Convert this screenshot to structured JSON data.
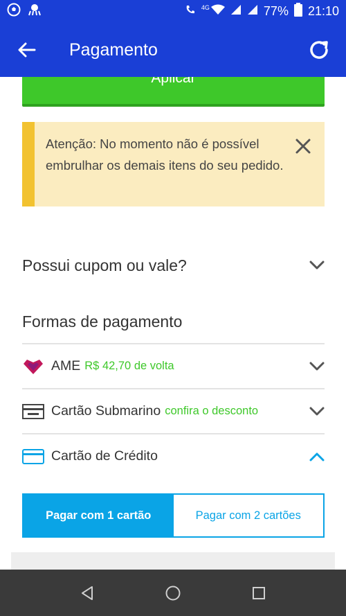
{
  "status": {
    "network": "4G",
    "battery": "77%",
    "time": "21:10"
  },
  "header": {
    "title": "Pagamento"
  },
  "apply": {
    "label": "Aplicar"
  },
  "alert": {
    "message": "Atenção: No momento não é possível embrulhar os demais itens do seu pedido."
  },
  "coupon": {
    "title": "Possui cupom ou vale?"
  },
  "payment": {
    "title": "Formas de pagamento",
    "methods": [
      {
        "name": "AME",
        "extra": "R$ 42,70 de volta",
        "icon": "ame-heart-icon",
        "expanded": false
      },
      {
        "name": "Cartão Submarino",
        "extra": "confira o desconto",
        "icon": "store-card-icon",
        "expanded": false
      },
      {
        "name": "Cartão de Crédito",
        "extra": "",
        "icon": "credit-card-icon",
        "expanded": true
      }
    ]
  },
  "card_tabs": [
    {
      "label": "Pagar com 1 cartão",
      "active": true
    },
    {
      "label": "Pagar com 2 cartões",
      "active": false
    }
  ],
  "colors": {
    "primary": "#1a3fd6",
    "success": "#3ec82a",
    "accent": "#0aa4e6",
    "alert_bg": "#fbecc0",
    "alert_bar": "#f2c230",
    "ame": "#c2185b"
  }
}
